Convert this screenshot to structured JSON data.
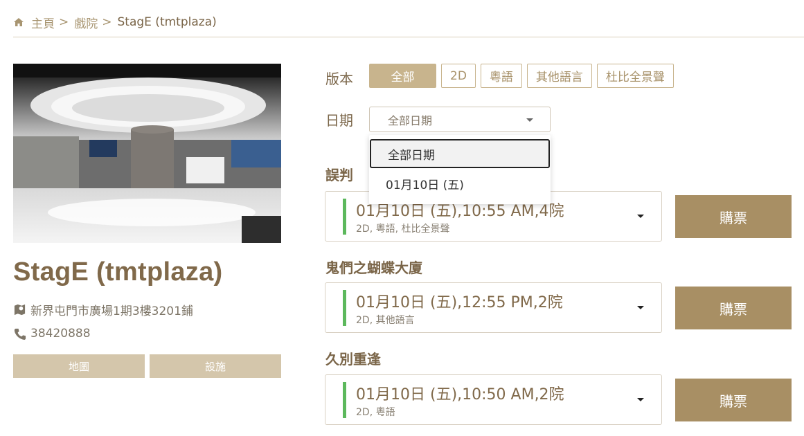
{
  "breadcrumb": {
    "home": "主頁",
    "theatres": "戲院",
    "current": "StagE (tmtplaza)",
    "separator": ">"
  },
  "cinema": {
    "name": "StagE (tmtplaza)",
    "address": "新界屯門市廣場1期3樓3201鋪",
    "phone": "38420888",
    "map_label": "地圖",
    "facilities_label": "設施"
  },
  "filters": {
    "version_label": "版本",
    "options": [
      "全部",
      "2D",
      "粵語",
      "其他語言",
      "杜比全景聲"
    ],
    "active": "全部",
    "date_label": "日期",
    "date_value": "全部日期",
    "date_options": [
      "全部日期",
      "01月10日 (五)"
    ]
  },
  "movies": [
    {
      "title": "誤判",
      "session": "01月10日 (五),10:55 AM,4院",
      "details": "2D, 粵語, 杜比全景聲",
      "buy": "購票"
    },
    {
      "title": "鬼們之蝴蝶大廈",
      "session": "01月10日 (五),12:55 PM,2院",
      "details": "2D, 其他語言",
      "buy": "購票"
    },
    {
      "title": "久別重逢",
      "session": "01月10日 (五),10:50 AM,2院",
      "details": "2D, 粵語",
      "buy": "購票"
    }
  ],
  "colors": {
    "accent": "#a88f64",
    "chip_active": "#c8b48d",
    "session_bar": "#5cb85c",
    "muted_button": "#d4c6ab"
  }
}
